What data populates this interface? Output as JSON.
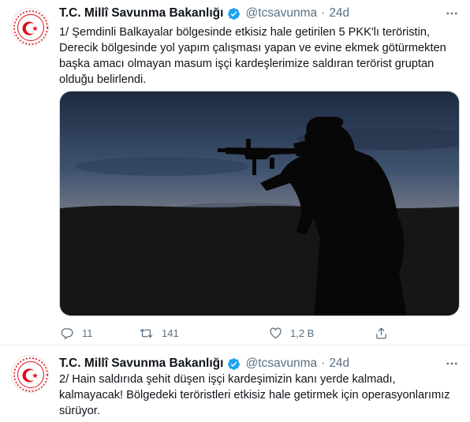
{
  "colors": {
    "text": "#0f1419",
    "secondary": "#5b7083",
    "verified": "#1da1f2",
    "emblem_red": "#e30a17",
    "border": "#e6ecf0"
  },
  "tweets": [
    {
      "author_name": "T.C. Millî Savunma Bakanlığı",
      "handle": "@tcsavunma",
      "separator": "·",
      "time": "24d",
      "lines": [
        "1/ Şemdinli Balkayalar bölgesinde etkisiz hale getirilen 5 PKK'lı teröristin,",
        "Derecik bölgesinde yol yapım çalışması yapan ve evine ekmek götürmekten",
        "başka amacı olmayan masum işçi kardeşlerimize saldıran terörist gruptan",
        "olduğu belirlendi."
      ],
      "media_icon": "soldier-silhouette-photo",
      "actions": {
        "reply_count": "11",
        "retweet_count": "141",
        "like_count": "1,2 B",
        "share_label": ""
      }
    },
    {
      "author_name": "T.C. Millî Savunma Bakanlığı",
      "handle": "@tcsavunma",
      "separator": "·",
      "time": "24d",
      "lines": [
        "2/ Hain saldırıda şehit düşen işçi kardeşimizin kanı yerde kalmadı,",
        "kalmayacak! Bölgedeki teröristleri etkisiz hale getirmek için operasyonlarımız",
        "sürüyor."
      ]
    }
  ],
  "icons": [
    "avatar-emblem-icon",
    "verified-badge-icon",
    "more-options-icon",
    "reply-icon",
    "retweet-icon",
    "like-icon",
    "share-icon"
  ]
}
